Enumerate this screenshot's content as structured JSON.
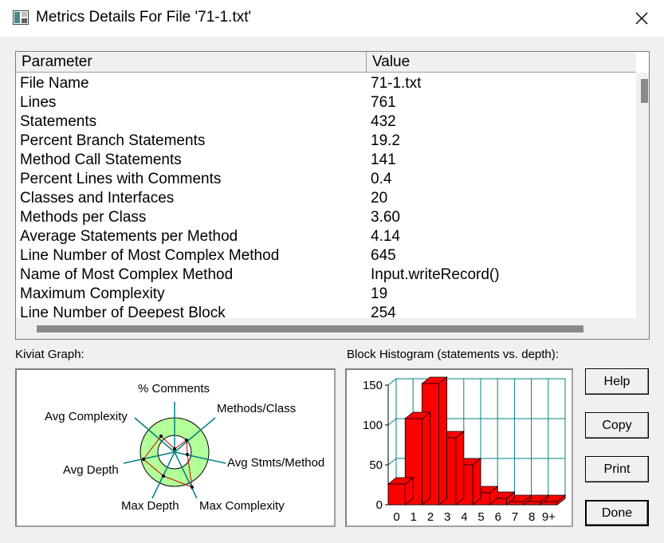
{
  "window": {
    "title": "Metrics Details For File '71-1.txt'"
  },
  "table": {
    "columns": [
      "Parameter",
      "Value"
    ],
    "rows": [
      {
        "parameter": "File Name",
        "value": "71-1.txt"
      },
      {
        "parameter": "Lines",
        "value": "761"
      },
      {
        "parameter": "Statements",
        "value": "432"
      },
      {
        "parameter": "Percent Branch Statements",
        "value": "19.2"
      },
      {
        "parameter": "Method Call Statements",
        "value": "141"
      },
      {
        "parameter": "Percent Lines with Comments",
        "value": "0.4"
      },
      {
        "parameter": "Classes and Interfaces",
        "value": "20"
      },
      {
        "parameter": "Methods per Class",
        "value": "3.60"
      },
      {
        "parameter": "Average Statements per Method",
        "value": "4.14"
      },
      {
        "parameter": "Line Number of Most Complex Method",
        "value": "645"
      },
      {
        "parameter": "Name of Most Complex Method",
        "value": "Input.writeRecord()"
      },
      {
        "parameter": "Maximum Complexity",
        "value": "19"
      },
      {
        "parameter": "Line Number of Deepest Block",
        "value": "254"
      }
    ]
  },
  "kiviat": {
    "label": "Kiviat Graph:",
    "axes": [
      "% Comments",
      "Methods/Class",
      "Avg Stmts/Method",
      "Max Complexity",
      "Max Depth",
      "Avg Depth",
      "Avg Complexity"
    ],
    "colors": {
      "ring": "#b3ff99",
      "axis": "#008080",
      "polygon": "#cc0000"
    }
  },
  "histogram": {
    "label": "Block Histogram (statements vs. depth):",
    "bar_color": "#ff0000",
    "grid_color": "#008080"
  },
  "chart_data": {
    "type": "bar",
    "categories": [
      "0",
      "1",
      "2",
      "3",
      "4",
      "5",
      "6",
      "7",
      "8",
      "9+"
    ],
    "values": [
      26,
      108,
      152,
      84,
      50,
      15,
      8,
      4,
      4,
      4
    ],
    "title": "Block Histogram (statements vs. depth):",
    "xlabel": "",
    "ylabel": "",
    "ylim": [
      0,
      150
    ],
    "yticks": [
      "0",
      "50",
      "100",
      "150"
    ]
  },
  "buttons": {
    "help": "Help",
    "copy": "Copy",
    "print": "Print",
    "done": "Done"
  }
}
